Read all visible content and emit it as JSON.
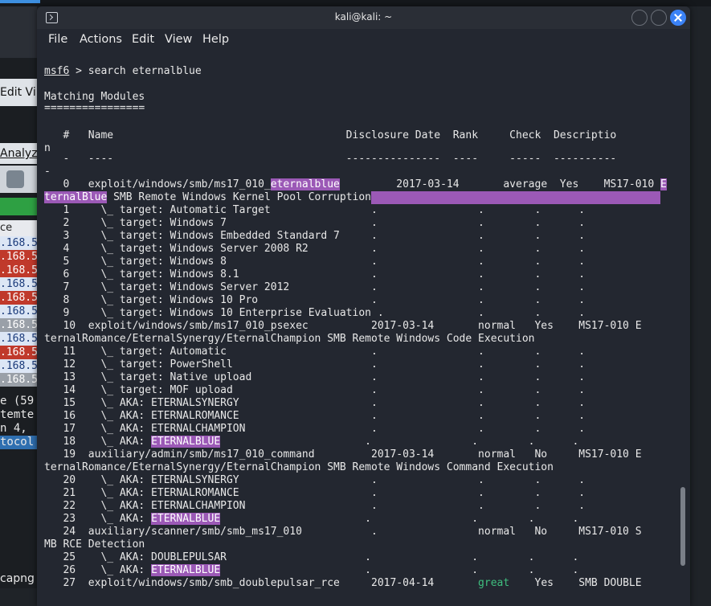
{
  "window": {
    "title": "kali@kali: ~",
    "menu": [
      "File",
      "Actions",
      "Edit",
      "View",
      "Help"
    ]
  },
  "background_app": {
    "menu_labels": "Edit  Vi",
    "analyze_label": "Analyz",
    "column_label": "ce",
    "rows": [
      ".168.5",
      ".168.5",
      ".168.5",
      ".168.5",
      ".168.5",
      ".168.5",
      ".168.5",
      ".168.5",
      ".168.5",
      ".168.5",
      ".168.5"
    ],
    "details": [
      "e (59",
      "temte",
      "n 4,",
      "tocol"
    ],
    "status": "capng"
  },
  "terminal": {
    "prompt": "msf6",
    "command": " > search eternalblue",
    "section_title": "Matching Modules",
    "section_rule": "================",
    "header": "   #   Name                                     Disclosure Date  Rank     Check  Descriptio",
    "header_wrap": "n",
    "rule_line": "   -   ----                                     ---------------  ----     -----  ----------",
    "rule_wrap": "-",
    "rows": [
      {
        "pre": "   0   exploit/windows/smb/ms17_010_",
        "hl": "eternalblue",
        "post": "         2017-03-14       average  Yes    MS17-010 ",
        "hl2": "E"
      },
      {
        "hl": "ternalBlue",
        "post": " SMB Remote Windows Kernel Pool Corruption",
        "fill": true
      },
      {
        "pre": "   1     \\_ target: Automatic Target                .                .        .      ."
      },
      {
        "pre": "   2     \\_ target: Windows 7                       .                .        .      ."
      },
      {
        "pre": "   3     \\_ target: Windows Embedded Standard 7     .                .        .      ."
      },
      {
        "pre": "   4     \\_ target: Windows Server 2008 R2          .                .        .      ."
      },
      {
        "pre": "   5     \\_ target: Windows 8                       .                .        .      ."
      },
      {
        "pre": "   6     \\_ target: Windows 8.1                     .                .        .      ."
      },
      {
        "pre": "   7     \\_ target: Windows Server 2012             .                .        .      ."
      },
      {
        "pre": "   8     \\_ target: Windows 10 Pro                  .                .        .      ."
      },
      {
        "pre": "   9     \\_ target: Windows 10 Enterprise Evaluation .               .        .      ."
      },
      {
        "pre": "   10  exploit/windows/smb/ms17_010_psexec          2017-03-14       normal   Yes    MS17-010 E"
      },
      {
        "pre": "ternalRomance/EternalSynergy/EternalChampion SMB Remote Windows Code Execution"
      },
      {
        "pre": "   11    \\_ target: Automatic                       .                .        .      ."
      },
      {
        "pre": "   12    \\_ target: PowerShell                      .                .        .      ."
      },
      {
        "pre": "   13    \\_ target: Native upload                   .                .        .      ."
      },
      {
        "pre": "   14    \\_ target: MOF upload                      .                .        .      ."
      },
      {
        "pre": "   15    \\_ AKA: ETERNALSYNERGY                     .                .        .      ."
      },
      {
        "pre": "   16    \\_ AKA: ETERNALROMANCE                     .                .        .      ."
      },
      {
        "pre": "   17    \\_ AKA: ETERNALCHAMPION                    .                .        .      ."
      },
      {
        "pre": "   18    \\_ AKA: ",
        "hl": "ETERNALBLUE",
        "post": "                       .                .        .      ."
      },
      {
        "pre": "   19  auxiliary/admin/smb/ms17_010_command         2017-03-14       normal   No     MS17-010 E"
      },
      {
        "pre": "ternalRomance/EternalSynergy/EternalChampion SMB Remote Windows Command Execution"
      },
      {
        "pre": "   20    \\_ AKA: ETERNALSYNERGY                     .                .        .      ."
      },
      {
        "pre": "   21    \\_ AKA: ETERNALROMANCE                     .                .        .      ."
      },
      {
        "pre": "   22    \\_ AKA: ETERNALCHAMPION                    .                .        .      ."
      },
      {
        "pre": "   23    \\_ AKA: ",
        "hl": "ETERNALBLUE",
        "post": "                       .                .        .      ."
      },
      {
        "pre": "   24  auxiliary/scanner/smb/smb_ms17_010           .                normal   No     MS17-010 S"
      },
      {
        "pre": "MB RCE Detection"
      },
      {
        "pre": "   25    \\_ AKA: DOUBLEPULSAR                      .                .        .      ."
      },
      {
        "pre": "   26    \\_ AKA: ",
        "hl": "ETERNALBLUE",
        "post": "                       .                .        .      ."
      },
      {
        "pre": "   27  exploit/windows/smb/smb_doublepulsar_rce     2017-04-14       ",
        "green": "great",
        "post": "    Yes    SMB DOUBLE"
      }
    ]
  },
  "colors": {
    "terminal_bg": "#232730",
    "highlight": "#9b59b6",
    "rank_great": "#3fbf7f",
    "close_button": "#3b82f6"
  }
}
